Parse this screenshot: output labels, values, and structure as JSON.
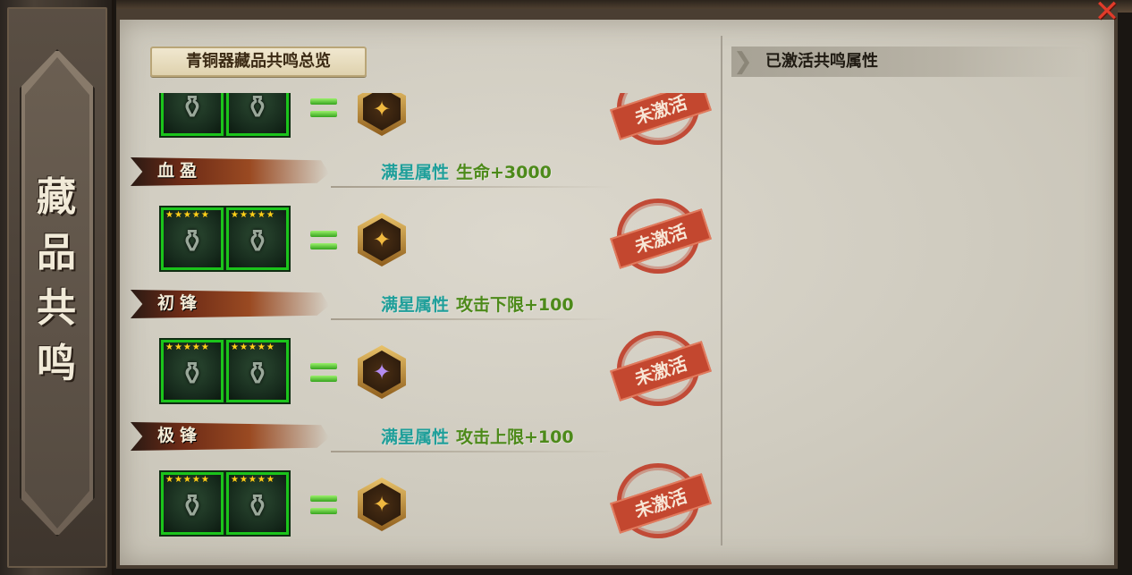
{
  "side_title": "藏品共鸣",
  "close_icon": "✕",
  "left_header": "青铜器藏品共鸣总览",
  "right_header": "已激活共鸣属性",
  "status_label": "未激活",
  "attr_prefix": "满星属性",
  "groups": [
    {
      "name": "",
      "attribute": "",
      "stars_a": "",
      "stars_b": "",
      "badge": "gold"
    },
    {
      "name": "血盈",
      "attribute": "生命+3000",
      "stars_a": "★★★★★",
      "stars_b": "★★★★★",
      "badge": "gold"
    },
    {
      "name": "初锋",
      "attribute": "攻击下限+100",
      "stars_a": "★★★★★",
      "stars_b": "★★★★★",
      "badge": "purple"
    },
    {
      "name": "极锋",
      "attribute": "攻击上限+100",
      "stars_a": "★★★★★",
      "stars_b": "★★★★★",
      "badge": "gold"
    }
  ],
  "icons": {
    "item_glyph": "⚱",
    "badge_glyph": "✦"
  }
}
